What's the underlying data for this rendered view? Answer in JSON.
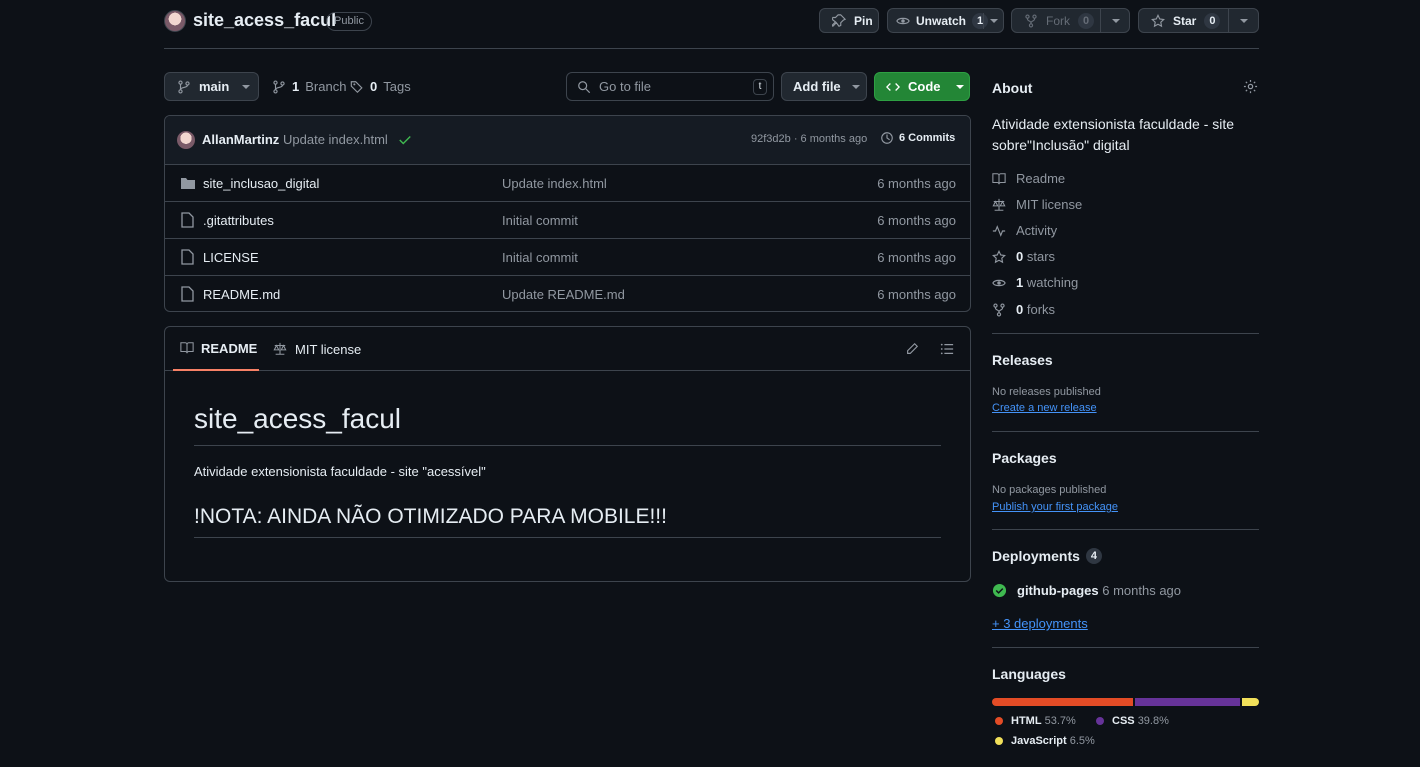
{
  "repo": {
    "name": "site_acess_facul",
    "visibility": "Public"
  },
  "actions": {
    "pin_label": "Pin",
    "unwatch_label": "Unwatch",
    "unwatch_count": "1",
    "fork_label": "Fork",
    "fork_count": "0",
    "star_label": "Star",
    "star_count": "0"
  },
  "toolbar": {
    "branch": "main",
    "branches_count": "1",
    "branches_label": "Branch",
    "tags_count": "0",
    "tags_label": "Tags",
    "search_placeholder": "Go to file",
    "search_shortcut": "t",
    "add_file_label": "Add file",
    "code_label": "Code"
  },
  "commit": {
    "author": "AllanMartinz",
    "message": "Update index.html",
    "hash_time": "92f3d2b · 6 months ago",
    "commits_label": "6 Commits"
  },
  "files": [
    {
      "name": "site_inclusao_digital",
      "type": "folder",
      "message": "Update index.html",
      "time": "6 months ago"
    },
    {
      "name": ".gitattributes",
      "type": "file",
      "message": "Initial commit",
      "time": "6 months ago"
    },
    {
      "name": "LICENSE",
      "type": "file",
      "message": "Initial commit",
      "time": "6 months ago"
    },
    {
      "name": "README.md",
      "type": "file",
      "message": "Update README.md",
      "time": "6 months ago"
    }
  ],
  "readme": {
    "tab_readme": "README",
    "tab_license": "MIT license",
    "title": "site_acess_facul",
    "paragraph": "Atividade extensionista faculdade - site \"acessível\"",
    "note": "!NOTA: AINDA NÃO OTIMIZADO PARA MOBILE!!!"
  },
  "about": {
    "heading": "About",
    "description": "Atividade extensionista faculdade - site sobre\"Inclusão\" digital",
    "readme": "Readme",
    "license": "MIT license",
    "activity": "Activity",
    "stars_count": "0",
    "stars_label": "stars",
    "watching_count": "1",
    "watching_label": "watching",
    "forks_count": "0",
    "forks_label": "forks"
  },
  "releases": {
    "heading": "Releases",
    "empty": "No releases published",
    "link": "Create a new release"
  },
  "packages": {
    "heading": "Packages",
    "empty": "No packages published",
    "link": "Publish your first package"
  },
  "deployments": {
    "heading": "Deployments",
    "count": "4",
    "name": "github-pages",
    "time": "6 months ago",
    "more": "+ 3 deployments"
  },
  "languages": {
    "heading": "Languages",
    "items": [
      {
        "name": "HTML",
        "percent": "53.7%",
        "value": 53.7,
        "color": "#e34c26"
      },
      {
        "name": "CSS",
        "percent": "39.8%",
        "value": 39.8,
        "color": "#663399"
      },
      {
        "name": "JavaScript",
        "percent": "6.5%",
        "value": 6.5,
        "color": "#f1e05a"
      }
    ]
  },
  "colors": {
    "background": "#0d1117",
    "border": "#3d444d",
    "accent_green": "#238636",
    "link": "#4493f8",
    "active_tab": "#f78166"
  }
}
